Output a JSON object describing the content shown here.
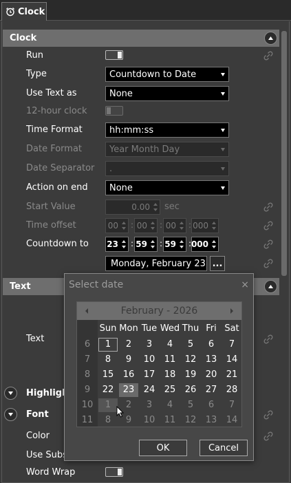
{
  "tab": {
    "title": "Clock",
    "icon": "alarm-clock-icon"
  },
  "sections": {
    "clock": "Clock",
    "text": "Text",
    "highlight": "Highligh",
    "font": "Font"
  },
  "properties": {
    "run": {
      "label": "Run",
      "toggle": "on"
    },
    "type": {
      "label": "Type",
      "value": "Countdown to Date"
    },
    "use_text_as": {
      "label": "Use Text as",
      "value": "None"
    },
    "twelve_hour": {
      "label": "12-hour clock",
      "toggle": "off"
    },
    "time_format": {
      "label": "Time Format",
      "value": "hh:mm:ss"
    },
    "date_format": {
      "label": "Date Format",
      "value": "Year Month Day"
    },
    "date_separator": {
      "label": "Date Separator",
      "value": "."
    },
    "action_on_end": {
      "label": "Action on end",
      "value": "None"
    },
    "start_value": {
      "label": "Start Value",
      "value": "0.00",
      "unit": "sec"
    },
    "time_offset": {
      "label": "Time offset",
      "h": "00",
      "m": "00",
      "s": "00",
      "ms": "000"
    },
    "countdown_to": {
      "label": "Countdown to",
      "h": "23",
      "m": "59",
      "s": "59",
      "ms": "000",
      "date": "Monday, February 23,",
      "ellipsis": "..."
    },
    "text": {
      "label": "Text"
    },
    "color": {
      "label": "Color"
    },
    "use_subs": {
      "label": "Use Subs"
    },
    "word_wrap": {
      "label": "Word Wrap",
      "toggle": "on"
    }
  },
  "dialog": {
    "title": "Select date",
    "close": "×",
    "month_year": "February - 2026",
    "weekdays": [
      "Sun",
      "Mon",
      "Tue",
      "Wed",
      "Thu",
      "Fri",
      "Sat"
    ],
    "weeks": [
      {
        "wk": "6",
        "days": [
          "1",
          "2",
          "3",
          "4",
          "5",
          "6",
          "7"
        ]
      },
      {
        "wk": "7",
        "days": [
          "8",
          "9",
          "10",
          "11",
          "12",
          "13",
          "14"
        ]
      },
      {
        "wk": "8",
        "days": [
          "15",
          "16",
          "17",
          "18",
          "19",
          "20",
          "21"
        ]
      },
      {
        "wk": "9",
        "days": [
          "22",
          "23",
          "24",
          "25",
          "26",
          "27",
          "28"
        ]
      },
      {
        "wk": "10",
        "days": [
          "1",
          "2",
          "3",
          "4",
          "5",
          "6",
          "7"
        ]
      },
      {
        "wk": "11",
        "days": [
          "8",
          "9",
          "10",
          "11",
          "12",
          "13",
          "14"
        ]
      }
    ],
    "ok": "OK",
    "cancel": "Cancel"
  }
}
